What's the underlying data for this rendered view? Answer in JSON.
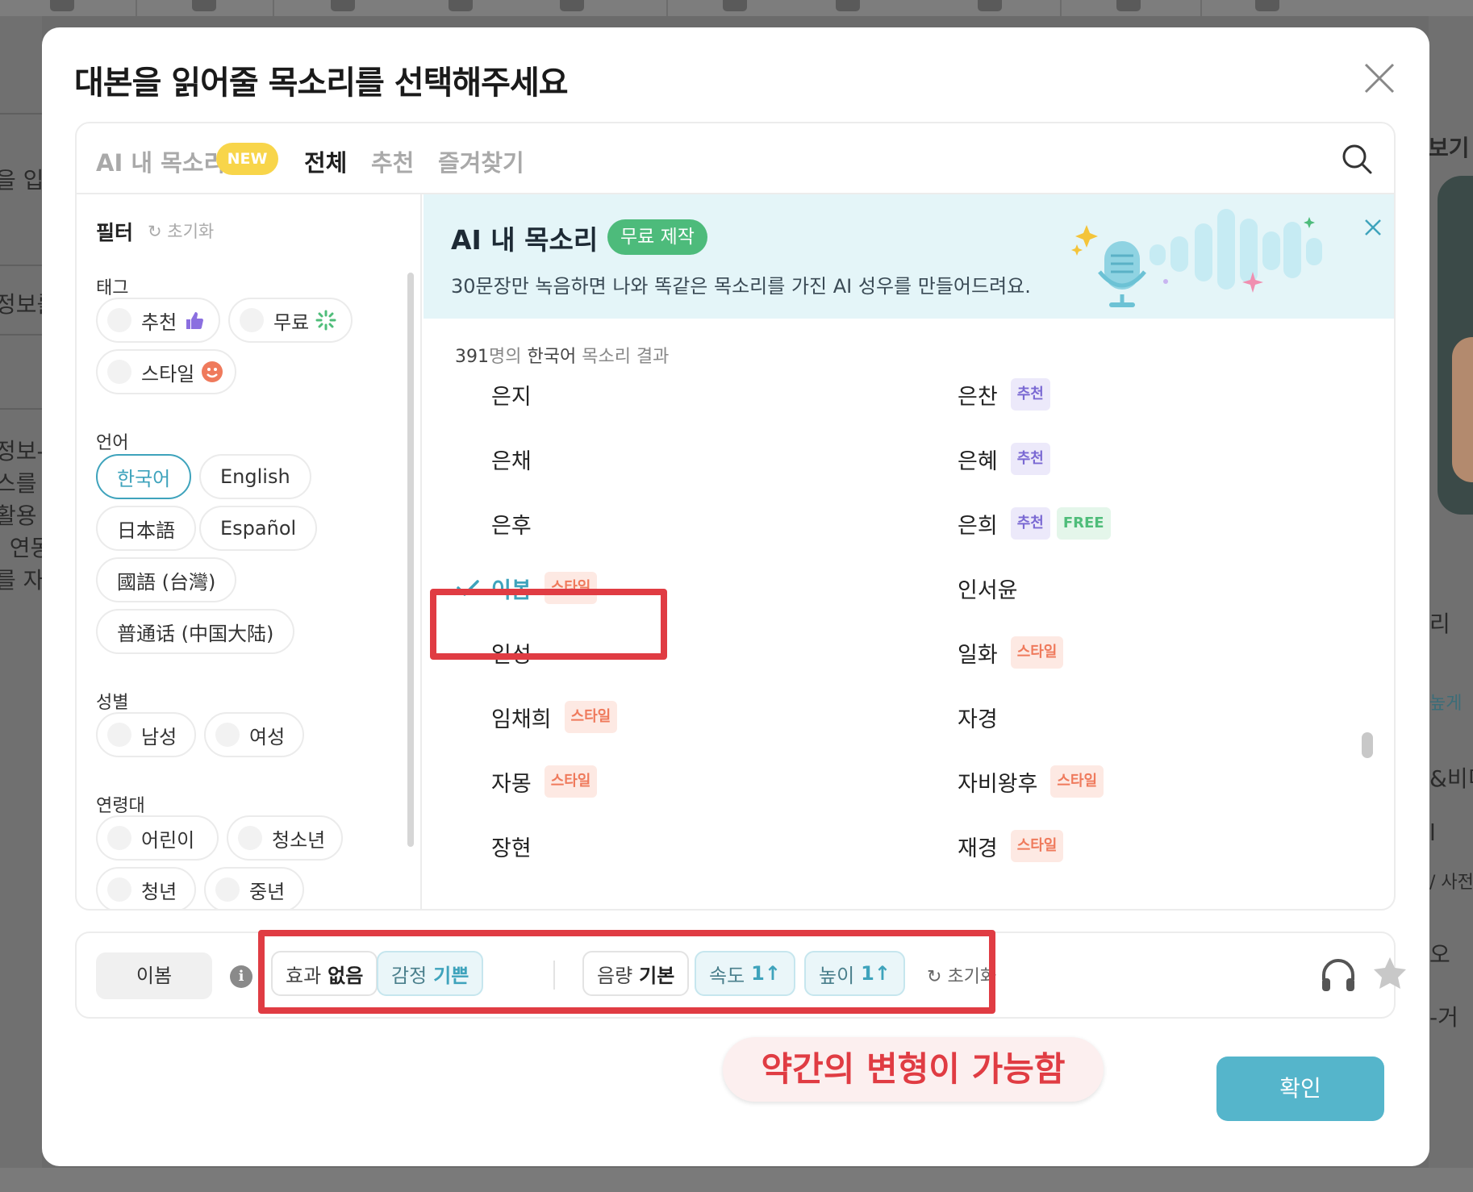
{
  "background": {
    "left_texts": [
      "을 입",
      "정보를",
      "정보-",
      "스를 -",
      "활용",
      ". 연동",
      "를 자!"
    ],
    "right_texts": [
      "보기",
      "리",
      "높게",
      "&비디",
      "l",
      "/ 사전",
      "오",
      "-거"
    ]
  },
  "modal": {
    "title": "대본을 읽어줄 목소리를 선택해주세요",
    "close_icon": "close-icon"
  },
  "tabs": {
    "items": [
      {
        "label": "AI 내 목소리",
        "active": false
      },
      {
        "label": "전체",
        "active": true
      },
      {
        "label": "추천",
        "active": false
      },
      {
        "label": "즐겨찾기",
        "active": false
      }
    ],
    "new_badge": "NEW"
  },
  "filters": {
    "title": "필터",
    "reset": "초기화",
    "tag_label": "태그",
    "tags": [
      "추천",
      "무료",
      "스타일"
    ],
    "language_label": "언어",
    "languages": [
      "한국어",
      "English",
      "日本語",
      "Español",
      "國語 (台灣)",
      "普通话 (中国大陆)"
    ],
    "selected_language": "한국어",
    "gender_label": "성별",
    "genders": [
      "남성",
      "여성"
    ],
    "age_label": "연령대",
    "ages": [
      "어린이",
      "청소년",
      "청년",
      "중년"
    ]
  },
  "promo": {
    "title": "AI 내 목소리",
    "badge": "무료 제작",
    "description": "30문장만 녹음하면 나와 똑같은 목소리를 가진 AI 성우를 만들어드려요."
  },
  "results": {
    "count": "391",
    "count_suffix_1": "명의 ",
    "language": "한국어",
    "count_suffix_2": " 목소리 결과"
  },
  "tag_labels": {
    "style": "스타일",
    "rec": "추천",
    "free": "FREE"
  },
  "voices": {
    "left": [
      {
        "name": "은지",
        "tags": []
      },
      {
        "name": "은채",
        "tags": []
      },
      {
        "name": "은후",
        "tags": []
      },
      {
        "name": "이봄",
        "tags": [
          "style"
        ],
        "selected": true
      },
      {
        "name": "일성",
        "tags": []
      },
      {
        "name": "임채희",
        "tags": [
          "style"
        ]
      },
      {
        "name": "자몽",
        "tags": [
          "style"
        ]
      },
      {
        "name": "장현",
        "tags": []
      }
    ],
    "right": [
      {
        "name": "은찬",
        "tags": [
          "rec"
        ]
      },
      {
        "name": "은혜",
        "tags": [
          "rec"
        ]
      },
      {
        "name": "은희",
        "tags": [
          "rec",
          "free"
        ]
      },
      {
        "name": "인서윤",
        "tags": []
      },
      {
        "name": "일화",
        "tags": [
          "style"
        ]
      },
      {
        "name": "자경",
        "tags": []
      },
      {
        "name": "자비왕후",
        "tags": [
          "style"
        ]
      },
      {
        "name": "재경",
        "tags": [
          "style"
        ]
      }
    ]
  },
  "controls": {
    "selected_voice": "이봄",
    "info": "i",
    "effect_label": "효과",
    "effect_value": "없음",
    "emotion_label": "감정",
    "emotion_value": "기쁜",
    "volume_label": "음량",
    "volume_value": "기본",
    "speed_label": "속도",
    "speed_value": "1↑",
    "pitch_label": "높이",
    "pitch_value": "1↑",
    "reset": "초기화"
  },
  "annotation": "약간의 변형이 가능함",
  "confirm": "확인",
  "colors": {
    "accent": "#3ea3bc",
    "annotation_red": "#e03c43",
    "style_tag": "#ef7a5c",
    "rec_tag": "#7a69d3",
    "free_tag": "#4fbd7a",
    "promo_green": "#4dbb7b"
  }
}
